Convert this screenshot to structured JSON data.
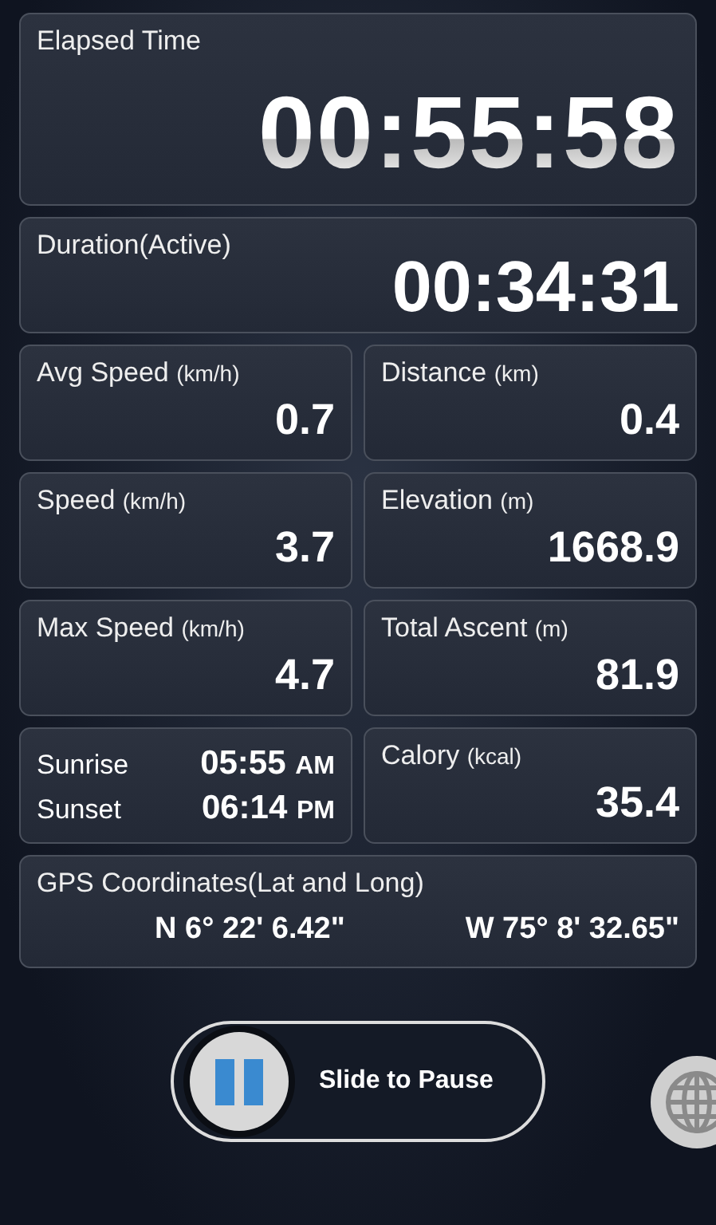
{
  "elapsed": {
    "label": "Elapsed Time",
    "value": "00:55:58"
  },
  "duration": {
    "label": "Duration(Active)",
    "value": "00:34:31"
  },
  "tiles": [
    {
      "kind": "metric",
      "label": "Avg Speed",
      "unit": "(km/h)",
      "value": "0.7"
    },
    {
      "kind": "metric",
      "label": "Distance",
      "unit": "(km)",
      "value": "0.4"
    },
    {
      "kind": "metric",
      "label": "Speed",
      "unit": "(km/h)",
      "value": "3.7"
    },
    {
      "kind": "metric",
      "label": "Elevation",
      "unit": "(m)",
      "value": "1668.9"
    },
    {
      "kind": "metric",
      "label": "Max Speed",
      "unit": "(km/h)",
      "value": "4.7"
    },
    {
      "kind": "metric",
      "label": "Total Ascent",
      "unit": "(m)",
      "value": "81.9"
    },
    {
      "kind": "sun",
      "rows": [
        {
          "label": "Sunrise",
          "time": "05:55",
          "ampm": "AM"
        },
        {
          "label": "Sunset",
          "time": "06:14",
          "ampm": "PM"
        }
      ]
    },
    {
      "kind": "metric",
      "label": "Calory",
      "unit": "(kcal)",
      "value": "35.4"
    }
  ],
  "gps": {
    "label": "GPS Coordinates(Lat and Long)",
    "lat": "N 6° 22' 6.42\"",
    "long": "W 75° 8' 32.65\""
  },
  "slider": {
    "label": "Slide to Pause",
    "level": 0
  }
}
